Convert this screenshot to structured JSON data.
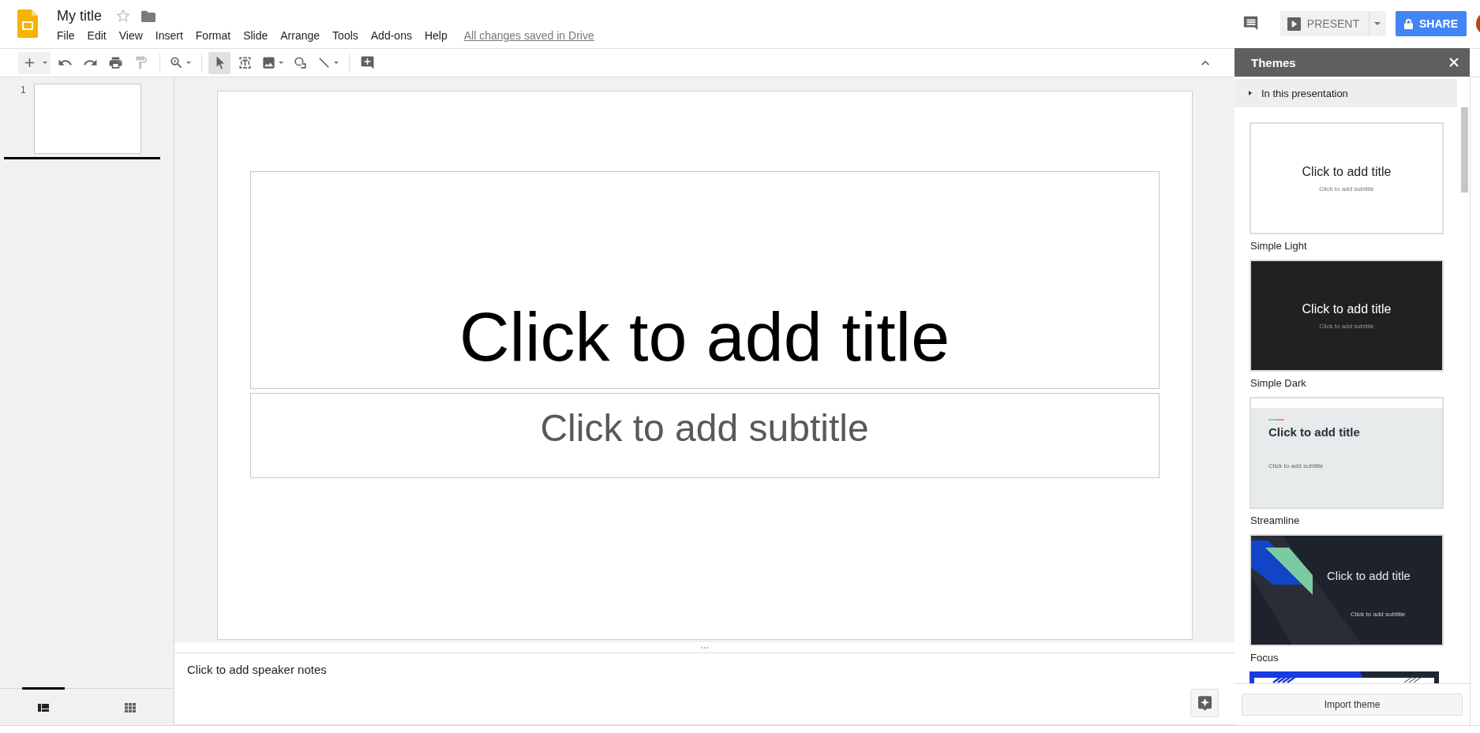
{
  "document": {
    "title": "My title",
    "starred": false,
    "save_status": "All changes saved in Drive"
  },
  "menus": [
    "File",
    "Edit",
    "View",
    "Insert",
    "Format",
    "Slide",
    "Arrange",
    "Tools",
    "Add-ons",
    "Help"
  ],
  "header": {
    "present_label": "PRESENT",
    "share_label": "SHARE"
  },
  "toolbar": {
    "groups": [
      [
        {
          "kind": "new_slide",
          "selected": false,
          "disabled": false,
          "has_menu": true
        },
        {
          "kind": "undo",
          "selected": false,
          "disabled": false,
          "has_menu": false
        },
        {
          "kind": "redo",
          "selected": false,
          "disabled": false,
          "has_menu": false
        },
        {
          "kind": "print",
          "selected": false,
          "disabled": false,
          "has_menu": false
        },
        {
          "kind": "paint_format",
          "selected": false,
          "disabled": true,
          "has_menu": false
        }
      ],
      [
        {
          "kind": "zoom",
          "selected": false,
          "disabled": false,
          "has_menu": true
        }
      ],
      [
        {
          "kind": "select",
          "selected": true,
          "disabled": false,
          "has_menu": false
        },
        {
          "kind": "text_box",
          "selected": false,
          "disabled": false,
          "has_menu": false
        },
        {
          "kind": "image",
          "selected": false,
          "disabled": false,
          "has_menu": true
        },
        {
          "kind": "shape",
          "selected": false,
          "disabled": false,
          "has_menu": false
        },
        {
          "kind": "line",
          "selected": false,
          "disabled": false,
          "has_menu": true
        }
      ],
      [
        {
          "kind": "comment",
          "selected": false,
          "disabled": false,
          "has_menu": false
        }
      ]
    ]
  },
  "filmstrip": {
    "slides": [
      {
        "number": "1",
        "selected": true
      }
    ],
    "views": [
      {
        "kind": "list",
        "selected": true
      },
      {
        "kind": "grid",
        "selected": false
      }
    ]
  },
  "slide": {
    "title_placeholder": "Click to add title",
    "subtitle_placeholder": "Click to add subtitle"
  },
  "notes": {
    "placeholder": "Click to add speaker notes"
  },
  "themes_panel": {
    "title": "Themes",
    "section": {
      "label": "In this presentation",
      "expanded": false
    },
    "themes": [
      {
        "kind": "simple_light",
        "name": "Simple Light",
        "title": "Click to add title",
        "subtitle": "Click to add subtitle"
      },
      {
        "kind": "simple_dark",
        "name": "Simple Dark",
        "title": "Click to add title",
        "subtitle": "Click to add subtitle"
      },
      {
        "kind": "streamline",
        "name": "Streamline",
        "title": "Click to add title",
        "subtitle": "Click to add subtitle"
      },
      {
        "kind": "focus",
        "name": "Focus",
        "title": "Click to add title",
        "subtitle": "Click to add subtitle"
      },
      {
        "kind": "stripes"
      }
    ],
    "import_label": "Import theme"
  }
}
